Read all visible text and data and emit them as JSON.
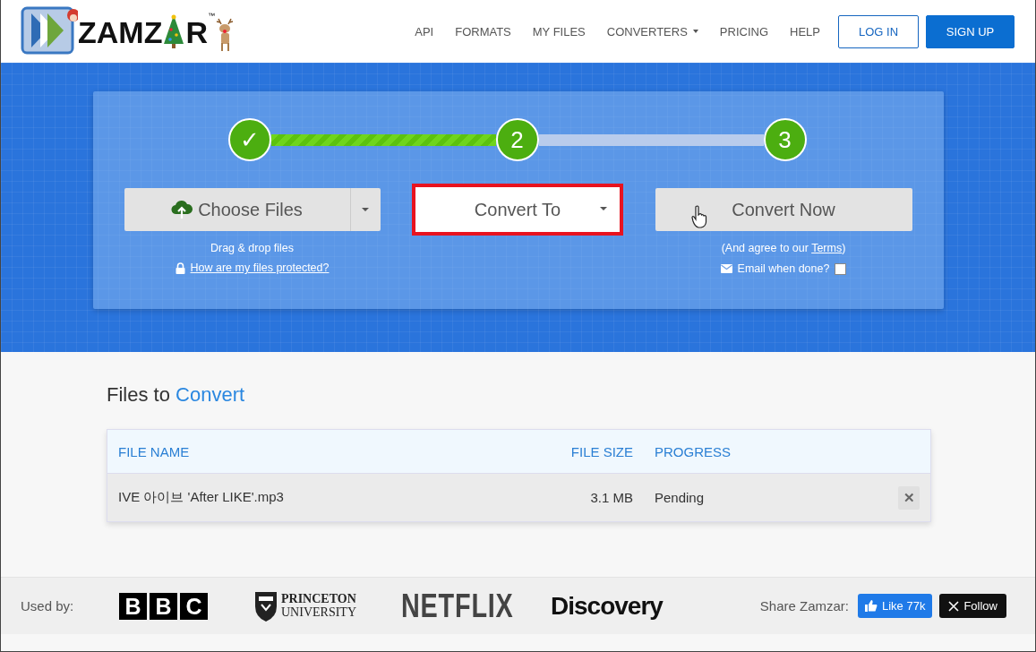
{
  "logo": {
    "text_before": "ZAMZ",
    "text_after": "R",
    "trademark": "™"
  },
  "nav": [
    {
      "label": "API",
      "dropdown": false
    },
    {
      "label": "FORMATS",
      "dropdown": false
    },
    {
      "label": "MY FILES",
      "dropdown": false
    },
    {
      "label": "CONVERTERS",
      "dropdown": true
    },
    {
      "label": "PRICING",
      "dropdown": false
    },
    {
      "label": "HELP",
      "dropdown": false
    }
  ],
  "auth_buttons": [
    {
      "label": "LOG IN",
      "kind": "outline"
    },
    {
      "label": "SIGN UP",
      "kind": "solid"
    }
  ],
  "steps": [
    {
      "label": "✓"
    },
    {
      "label": "2"
    },
    {
      "label": "3"
    }
  ],
  "connectors": [
    {
      "level": 1
    },
    {
      "level": 0
    }
  ],
  "choose_files": {
    "label": "Choose Files",
    "hint": "Drag & drop files",
    "link": "How are my files protected?"
  },
  "convert_to": {
    "label": "Convert To",
    "highlighted": true
  },
  "convert_now": {
    "label": "Convert Now",
    "note_before": "(And agree to our ",
    "note_link": "Terms",
    "note_after": ")",
    "email_label": "Email when done?",
    "email_checked": false
  },
  "files": {
    "title_plain": "Files to",
    "title_accent": "Convert",
    "columns": [
      "FILE NAME",
      "FILE SIZE",
      "PROGRESS"
    ],
    "rows": [
      {
        "file_name": "IVE 아이브 'After LIKE'.mp3",
        "file_size": "3.1 MB",
        "progress": "Pending",
        "remove": "✕"
      }
    ]
  },
  "footer": {
    "used_by": "Used by:",
    "brands": [
      {
        "kind": "bbc",
        "letters": [
          "B",
          "B",
          "C"
        ]
      },
      {
        "kind": "princeton",
        "lines": [
          "PRINCETON",
          "UNIVERSITY"
        ]
      },
      {
        "kind": "netflix",
        "text": "NETFLIX"
      },
      {
        "kind": "discovery",
        "text": "Discovery"
      }
    ],
    "share_label": "Share Zamzar:",
    "like": "Like 77k",
    "follow": "Follow"
  }
}
